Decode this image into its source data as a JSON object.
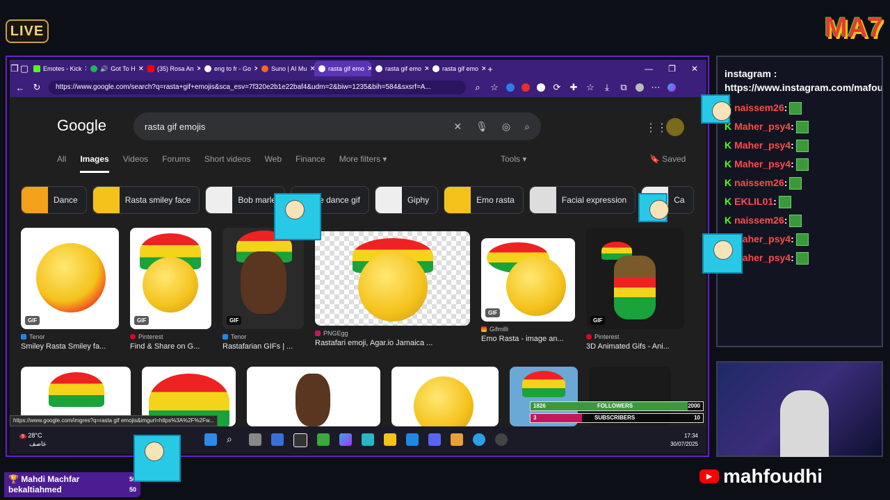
{
  "overlay": {
    "live_label": "LIVE",
    "brand_logo": "MA7",
    "youtube_handle": "mahfoudhi",
    "sub_alert": {
      "name": "Mahdi Machfar",
      "name2": "bekaltiahmed",
      "count1": "50",
      "count2": "50"
    }
  },
  "browser": {
    "tabs": [
      {
        "label": "Emotes - Kick",
        "color": "#53fc18"
      },
      {
        "label": "Got To H",
        "color": "#1db954"
      },
      {
        "label": "(35) Rosa An",
        "color": "#ff0000"
      },
      {
        "label": "eng to fr - Go",
        "color": "#ffffff"
      },
      {
        "label": "Suno | AI Mu",
        "color": "#f26b1d"
      },
      {
        "label": "rasta gif emo",
        "color": "#ffffff"
      },
      {
        "label": "rasta gif emo",
        "color": "#ffffff"
      },
      {
        "label": "rasta gif emo",
        "color": "#ffffff"
      }
    ],
    "url": "https://www.google.com/search?q=rasta+gif+emojis&sca_esv=7f320e2b1e22baf4&udm=2&biw=1235&bih=584&sxsrf=A...",
    "status_url": "https://www.google.com/imgres?q=rasta gif emojis&imgurl=https%3A%2F%2Fw..."
  },
  "google": {
    "logo": "Google",
    "query": "rasta gif emojis",
    "tabs": [
      "All",
      "Images",
      "Videos",
      "Forums",
      "Short videos",
      "Web",
      "Finance",
      "More filters"
    ],
    "tools": "Tools",
    "saved": "Saved",
    "chips": [
      "Dance",
      "Rasta smiley face",
      "Bob marle",
      "e dance gif",
      "Giphy",
      "Emo rasta",
      "Facial expression",
      "Ca"
    ],
    "row1": [
      {
        "source": "Tenor",
        "title": "Smiley Rasta Smiley fa...",
        "gif": "GIF"
      },
      {
        "source": "Pinterest",
        "title": "Find & Share on G...",
        "gif": "GIF"
      },
      {
        "source": "Tenor",
        "title": "Rastafarian GIFs | ...",
        "gif": "GIF"
      },
      {
        "source": "PNGEgg",
        "title": "Rastafari emoji, Agar.io Jamaica ...",
        "gif": ""
      },
      {
        "source": "Gifmilli",
        "title": "Emo Rasta - image an...",
        "gif": "GIF"
      },
      {
        "source": "Pinterest",
        "title": "3D Animated Gifs - Ani...",
        "gif": "GIF"
      }
    ]
  },
  "taskbar": {
    "temp": "28°C",
    "weather": "عاصف",
    "badge": "5",
    "time": "17:34",
    "date": "30/07/2025"
  },
  "goals": {
    "followers": {
      "label": "FOLLOWERS",
      "current": "1826",
      "target": "2000",
      "progress": 0.913
    },
    "subscribers": {
      "label": "SUBSCRIBERS",
      "current": "3",
      "target": "10",
      "progress": 0.3
    }
  },
  "chat": {
    "pinned": "instagram : https://www.instagram.com/mafoudhi_tn/",
    "messages": [
      {
        "user": "naissem26",
        "text": ":"
      },
      {
        "user": "Maher_psy4",
        "text": ":"
      },
      {
        "user": "Maher_psy4",
        "text": ":"
      },
      {
        "user": "Maher_psy4",
        "text": ":"
      },
      {
        "user": "naissem26",
        "text": ":"
      },
      {
        "user": "EKLIL01",
        "text": ":"
      },
      {
        "user": "naissem26",
        "text": ":"
      },
      {
        "user": "Maher_psy4",
        "text": ":"
      },
      {
        "user": "Maher_psy4",
        "text": ":"
      }
    ]
  }
}
